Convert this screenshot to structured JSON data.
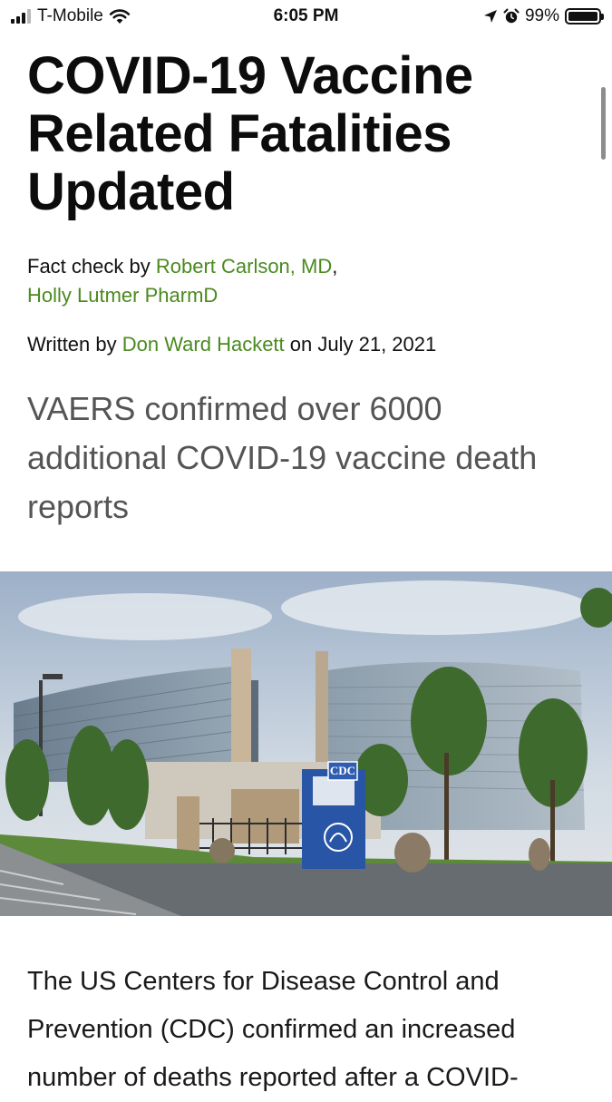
{
  "status_bar": {
    "carrier": "T-Mobile",
    "time": "6:05 PM",
    "battery": "99%",
    "battery_level": 0.99,
    "signal_bars_active": 3,
    "signal_bars_total": 4,
    "icons": [
      "wifi-icon",
      "location-arrow-icon",
      "alarm-icon",
      "battery-icon"
    ]
  },
  "article": {
    "title": "COVID-19 Vaccine Related Fatalities Updated",
    "fact_check_prefix": "Fact check by ",
    "fact_checker_1": "Robert Carlson, MD",
    "fact_check_separator": ",",
    "fact_checker_2": "Holly Lutmer PharmD",
    "written_prefix": "Written by ",
    "author": "Don Ward Hackett",
    "date_prefix": " on ",
    "date": "July 21, 2021",
    "subtitle": "VAERS confirmed over 6000 additional COVID-19 vaccine death reports",
    "hero_sign_text": "CDC",
    "body_text": "The US Centers for Disease Control and Prevention (CDC) confirmed an increased number of deaths reported after a COVID-"
  },
  "colors": {
    "link": "#4a8a1e",
    "subtitle": "#555555",
    "title": "#0c0c0c"
  }
}
